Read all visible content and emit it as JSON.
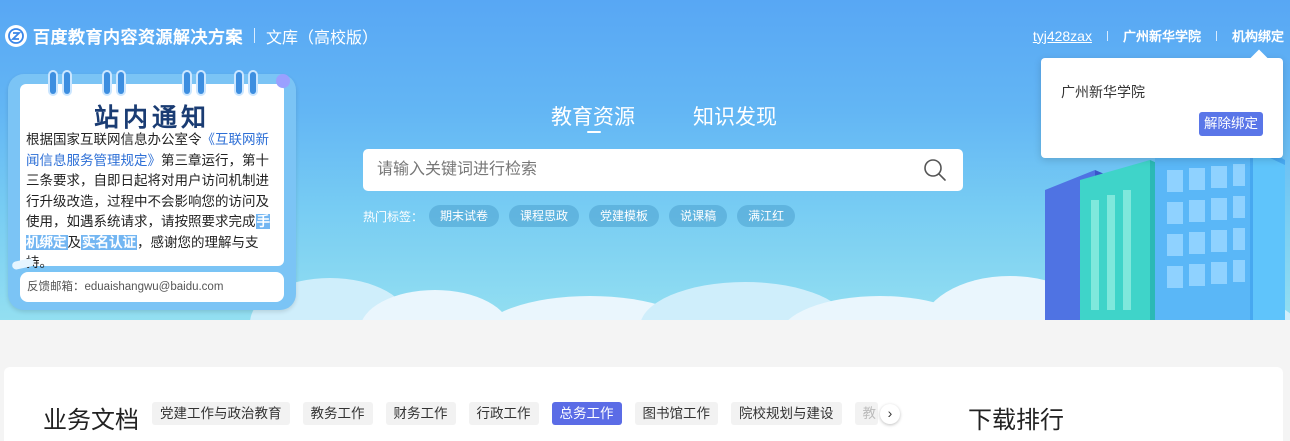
{
  "header": {
    "brand": "百度教育内容资源解决方案",
    "subtitle": "文库（高校版）",
    "username": "tyj428zax",
    "institution": "广州新华学院",
    "bind_link": "机构绑定"
  },
  "bind_popover": {
    "institution": "广州新华学院",
    "unbind_label": "解除绑定"
  },
  "notice": {
    "title": "站内通知",
    "body_intro": "根据国家互联网信息办公室令",
    "regulation_link": "《互联网新闻信息服务管理规定》",
    "body_mid": "第三章运行，第十三条要求，自即日起将对用户访问机制进行升级改造，过程中不会影响您的访问及使用，如遇系统请求，请按照要求完成",
    "phone_bind": "手机绑定",
    "conj": "及",
    "realname": "实名认证",
    "body_end": "，感谢您的理解与支持。",
    "feedback": "反馈邮箱：eduaishangwu@baidu.com"
  },
  "search": {
    "tabs": [
      {
        "label": "教育资源",
        "active": true
      },
      {
        "label": "知识发现",
        "active": false
      }
    ],
    "placeholder": "请输入关键词进行检索",
    "hot_label": "热门标签：",
    "hot_tags": [
      "期末试卷",
      "课程思政",
      "党建模板",
      "说课稿",
      "满江红"
    ]
  },
  "business": {
    "title": "业务文档",
    "categories": [
      {
        "label": "党建工作与政治教育",
        "active": false
      },
      {
        "label": "教务工作",
        "active": false
      },
      {
        "label": "财务工作",
        "active": false
      },
      {
        "label": "行政工作",
        "active": false
      },
      {
        "label": "总务工作",
        "active": true
      },
      {
        "label": "图书馆工作",
        "active": false
      },
      {
        "label": "院校规划与建设",
        "active": false
      },
      {
        "label": "教",
        "active": false
      }
    ],
    "next_icon": "chevron-right-icon"
  },
  "ranking": {
    "title": "下载排行"
  },
  "colors": {
    "hero_top": "#58a7f4",
    "hero_bottom": "#93dff1",
    "accent": "#5b6ce6",
    "notice_title": "#1a3c73"
  }
}
